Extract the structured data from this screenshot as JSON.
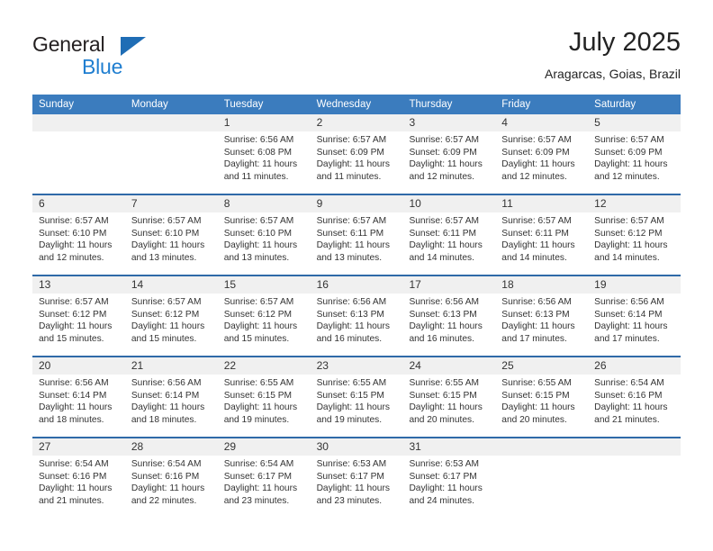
{
  "brand": {
    "name_part1": "General",
    "name_part2": "Blue",
    "accent_color": "#1f7ed0",
    "triangle_color": "#1f6db5"
  },
  "header": {
    "title": "July 2025",
    "subtitle": "Aragarcas, Goias, Brazil"
  },
  "theme": {
    "header_blue": "#3b7cbe",
    "separator_blue": "#2f6aa8",
    "day_band_gray": "#f0f0f0"
  },
  "weekdays": [
    "Sunday",
    "Monday",
    "Tuesday",
    "Wednesday",
    "Thursday",
    "Friday",
    "Saturday"
  ],
  "weeks": [
    [
      {
        "day": "",
        "lines": []
      },
      {
        "day": "",
        "lines": []
      },
      {
        "day": "1",
        "lines": [
          "Sunrise: 6:56 AM",
          "Sunset: 6:08 PM",
          "Daylight: 11 hours",
          "and 11 minutes."
        ]
      },
      {
        "day": "2",
        "lines": [
          "Sunrise: 6:57 AM",
          "Sunset: 6:09 PM",
          "Daylight: 11 hours",
          "and 11 minutes."
        ]
      },
      {
        "day": "3",
        "lines": [
          "Sunrise: 6:57 AM",
          "Sunset: 6:09 PM",
          "Daylight: 11 hours",
          "and 12 minutes."
        ]
      },
      {
        "day": "4",
        "lines": [
          "Sunrise: 6:57 AM",
          "Sunset: 6:09 PM",
          "Daylight: 11 hours",
          "and 12 minutes."
        ]
      },
      {
        "day": "5",
        "lines": [
          "Sunrise: 6:57 AM",
          "Sunset: 6:09 PM",
          "Daylight: 11 hours",
          "and 12 minutes."
        ]
      }
    ],
    [
      {
        "day": "6",
        "lines": [
          "Sunrise: 6:57 AM",
          "Sunset: 6:10 PM",
          "Daylight: 11 hours",
          "and 12 minutes."
        ]
      },
      {
        "day": "7",
        "lines": [
          "Sunrise: 6:57 AM",
          "Sunset: 6:10 PM",
          "Daylight: 11 hours",
          "and 13 minutes."
        ]
      },
      {
        "day": "8",
        "lines": [
          "Sunrise: 6:57 AM",
          "Sunset: 6:10 PM",
          "Daylight: 11 hours",
          "and 13 minutes."
        ]
      },
      {
        "day": "9",
        "lines": [
          "Sunrise: 6:57 AM",
          "Sunset: 6:11 PM",
          "Daylight: 11 hours",
          "and 13 minutes."
        ]
      },
      {
        "day": "10",
        "lines": [
          "Sunrise: 6:57 AM",
          "Sunset: 6:11 PM",
          "Daylight: 11 hours",
          "and 14 minutes."
        ]
      },
      {
        "day": "11",
        "lines": [
          "Sunrise: 6:57 AM",
          "Sunset: 6:11 PM",
          "Daylight: 11 hours",
          "and 14 minutes."
        ]
      },
      {
        "day": "12",
        "lines": [
          "Sunrise: 6:57 AM",
          "Sunset: 6:12 PM",
          "Daylight: 11 hours",
          "and 14 minutes."
        ]
      }
    ],
    [
      {
        "day": "13",
        "lines": [
          "Sunrise: 6:57 AM",
          "Sunset: 6:12 PM",
          "Daylight: 11 hours",
          "and 15 minutes."
        ]
      },
      {
        "day": "14",
        "lines": [
          "Sunrise: 6:57 AM",
          "Sunset: 6:12 PM",
          "Daylight: 11 hours",
          "and 15 minutes."
        ]
      },
      {
        "day": "15",
        "lines": [
          "Sunrise: 6:57 AM",
          "Sunset: 6:12 PM",
          "Daylight: 11 hours",
          "and 15 minutes."
        ]
      },
      {
        "day": "16",
        "lines": [
          "Sunrise: 6:56 AM",
          "Sunset: 6:13 PM",
          "Daylight: 11 hours",
          "and 16 minutes."
        ]
      },
      {
        "day": "17",
        "lines": [
          "Sunrise: 6:56 AM",
          "Sunset: 6:13 PM",
          "Daylight: 11 hours",
          "and 16 minutes."
        ]
      },
      {
        "day": "18",
        "lines": [
          "Sunrise: 6:56 AM",
          "Sunset: 6:13 PM",
          "Daylight: 11 hours",
          "and 17 minutes."
        ]
      },
      {
        "day": "19",
        "lines": [
          "Sunrise: 6:56 AM",
          "Sunset: 6:14 PM",
          "Daylight: 11 hours",
          "and 17 minutes."
        ]
      }
    ],
    [
      {
        "day": "20",
        "lines": [
          "Sunrise: 6:56 AM",
          "Sunset: 6:14 PM",
          "Daylight: 11 hours",
          "and 18 minutes."
        ]
      },
      {
        "day": "21",
        "lines": [
          "Sunrise: 6:56 AM",
          "Sunset: 6:14 PM",
          "Daylight: 11 hours",
          "and 18 minutes."
        ]
      },
      {
        "day": "22",
        "lines": [
          "Sunrise: 6:55 AM",
          "Sunset: 6:15 PM",
          "Daylight: 11 hours",
          "and 19 minutes."
        ]
      },
      {
        "day": "23",
        "lines": [
          "Sunrise: 6:55 AM",
          "Sunset: 6:15 PM",
          "Daylight: 11 hours",
          "and 19 minutes."
        ]
      },
      {
        "day": "24",
        "lines": [
          "Sunrise: 6:55 AM",
          "Sunset: 6:15 PM",
          "Daylight: 11 hours",
          "and 20 minutes."
        ]
      },
      {
        "day": "25",
        "lines": [
          "Sunrise: 6:55 AM",
          "Sunset: 6:15 PM",
          "Daylight: 11 hours",
          "and 20 minutes."
        ]
      },
      {
        "day": "26",
        "lines": [
          "Sunrise: 6:54 AM",
          "Sunset: 6:16 PM",
          "Daylight: 11 hours",
          "and 21 minutes."
        ]
      }
    ],
    [
      {
        "day": "27",
        "lines": [
          "Sunrise: 6:54 AM",
          "Sunset: 6:16 PM",
          "Daylight: 11 hours",
          "and 21 minutes."
        ]
      },
      {
        "day": "28",
        "lines": [
          "Sunrise: 6:54 AM",
          "Sunset: 6:16 PM",
          "Daylight: 11 hours",
          "and 22 minutes."
        ]
      },
      {
        "day": "29",
        "lines": [
          "Sunrise: 6:54 AM",
          "Sunset: 6:17 PM",
          "Daylight: 11 hours",
          "and 23 minutes."
        ]
      },
      {
        "day": "30",
        "lines": [
          "Sunrise: 6:53 AM",
          "Sunset: 6:17 PM",
          "Daylight: 11 hours",
          "and 23 minutes."
        ]
      },
      {
        "day": "31",
        "lines": [
          "Sunrise: 6:53 AM",
          "Sunset: 6:17 PM",
          "Daylight: 11 hours",
          "and 24 minutes."
        ]
      },
      {
        "day": "",
        "lines": []
      },
      {
        "day": "",
        "lines": []
      }
    ]
  ]
}
